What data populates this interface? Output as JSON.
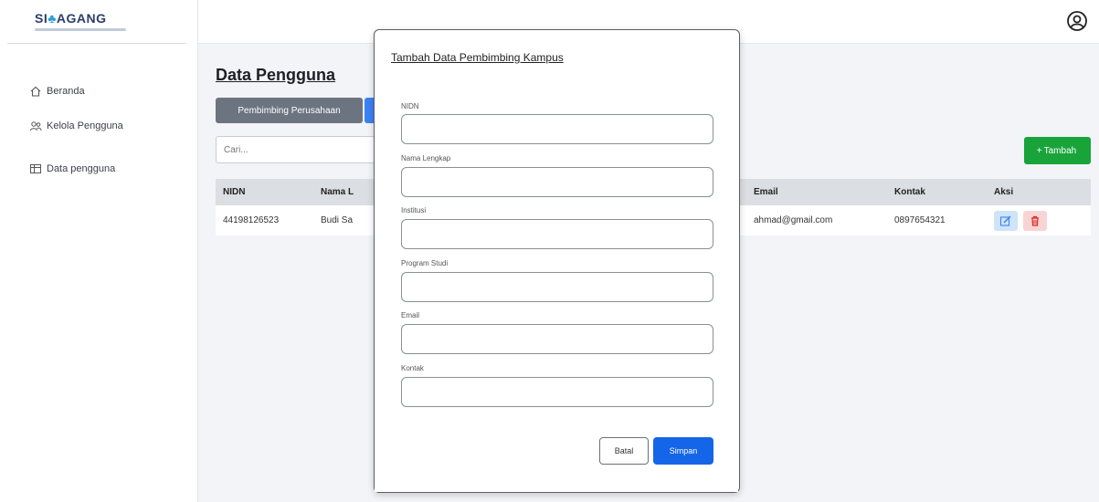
{
  "app": {
    "logo_text_a": "SI",
    "logo_text_b": "AGANG"
  },
  "sidebar": {
    "items": [
      {
        "label": "Beranda",
        "icon": "home-icon"
      },
      {
        "label": "Kelola Pengguna",
        "icon": "users-icon"
      },
      {
        "label": "Data pengguna",
        "icon": "table-icon"
      }
    ]
  },
  "topbar": {
    "profile_icon": "user-circle-icon"
  },
  "main": {
    "title": "Data Pengguna",
    "tab_label": "Pembimbing Perusahaan",
    "search_placeholder": "Cari...",
    "add_label": "Tambah",
    "table": {
      "headers": [
        "NIDN",
        "Nama L",
        "Email",
        "Kontak",
        "Aksi"
      ],
      "rows": [
        {
          "nidn": "44198126523",
          "nama": "Budi Sa",
          "email": "ahmad@gmail.com",
          "kontak": "0897654321"
        }
      ]
    }
  },
  "modal": {
    "title": "Tambah Data Pembimbing Kampus",
    "fields": [
      {
        "label": "NIDN",
        "value": ""
      },
      {
        "label": "Nama Lengkap",
        "value": ""
      },
      {
        "label": "Institusi",
        "value": ""
      },
      {
        "label": "Program Studi",
        "value": ""
      },
      {
        "label": "Email",
        "value": ""
      },
      {
        "label": "Kontak",
        "value": ""
      }
    ],
    "cancel_label": "Batal",
    "save_label": "Simpan"
  },
  "colors": {
    "primary": "#1565e8",
    "success": "#19a43a",
    "secondary": "#6c7480",
    "danger_bg": "#f9d4d4",
    "info_bg": "#cfe4f7"
  }
}
